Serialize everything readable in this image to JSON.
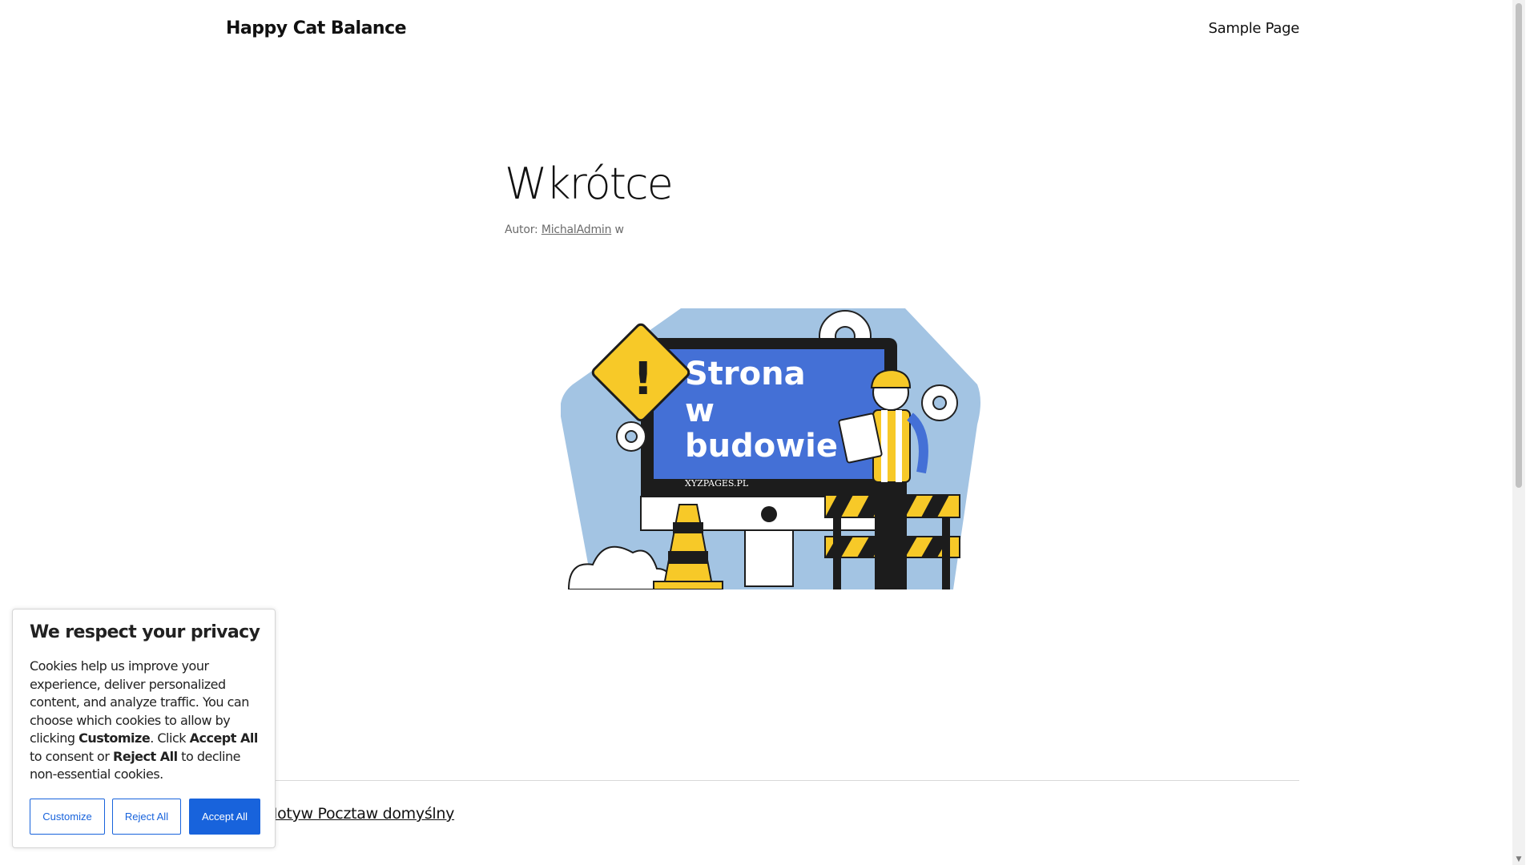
{
  "header": {
    "site_title": "Happy Cat Balance",
    "nav": [
      "Sample Page"
    ]
  },
  "post": {
    "title": "Wkrótce",
    "meta_prefix": "Autor:",
    "author": "MichalAdmin",
    "meta_suffix": "w"
  },
  "illustration": {
    "sign_text": "Strona w budowie",
    "site_url": "XYZPAGES.PL"
  },
  "footer": {
    "link": "Motyw Pocztaw domyślny"
  },
  "cookie_banner": {
    "title": "We respect your privacy",
    "body_1": "Cookies help us improve your experience, deliver personalized content, and analyze traffic. You can choose which cookies to allow by clicking ",
    "bold_customize": "Customize",
    "body_2": ". Click ",
    "bold_accept": "Accept All",
    "body_3": " to consent or ",
    "bold_reject": "Reject All",
    "body_4": " to decline non-essential cookies.",
    "buttons": {
      "customize": "Customize",
      "reject": "Reject All",
      "accept": "Accept All"
    }
  },
  "colors": {
    "accent": "#1863dc",
    "illustration_blue": "#a3c4e3",
    "screen_blue": "#4470d6",
    "warning_yellow": "#f7c928"
  }
}
